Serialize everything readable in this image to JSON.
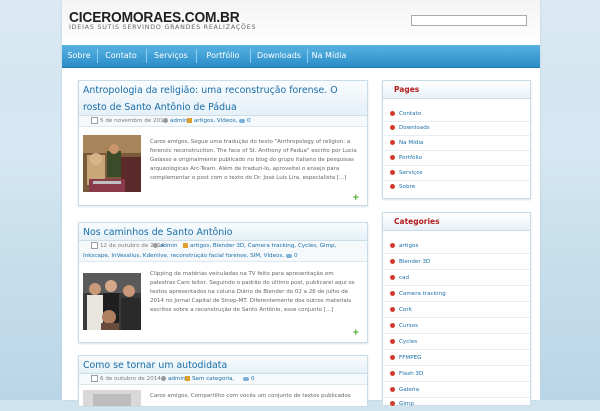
{
  "site": {
    "logo": "CICEROMORAES.COM.BR",
    "tagline": "IDEIAS SUTIS SERVINDO GRANDES REALIZAÇÕES"
  },
  "search": {
    "value": ""
  },
  "nav": [
    {
      "label": "Sobre"
    },
    {
      "label": "Contato"
    },
    {
      "label": "Serviços"
    },
    {
      "label": "Portfólio"
    },
    {
      "label": "Downloads"
    },
    {
      "label": "Na Mídia"
    }
  ],
  "posts": [
    {
      "title": "Antropologia da religião: uma reconstrução forense. O rosto de Santo Antônio de Pádua",
      "date": "5 de novembro de 2014",
      "author": "admin",
      "tags": "artigos, Vídeos,",
      "comments": "0",
      "excerpt": "Caros amigos, Segue uma tradução do texto \"Anthropology of religion: a forensic reconstruction. The face of St. Anthony of Padua\" escrito por Lucia Galasso e originalmente publicado no blog do grupo italiano de pesquisas arqueológicas Arc-Team. Além de traduzi-lo, aproveitei o ensejo para complementar o post com o texto do Dr. José Luís Lira, especialista [...]"
    },
    {
      "title": "Nos caminhos de Santo Antônio",
      "date": "12 de outubro de 2014",
      "author": "admin",
      "tags": "artigos, Blender 3D, Camera tracking, Cycles, Gimp, Inkscape, InVesalius, Kdenlive, reconstrução facial forense, SIM, Vídeos,",
      "comments": "0",
      "excerpt": "Clipping de matérias veiculadas na TV feito para apresentação em palestras Caro leitor, Seguindo o padrão do último post, publicarei aqui os textos apresentados na coluna Diário de Blender do 02 a 26 de julho de 2014 no Jornal Capital de Sinop-MT. Diferentemente dos outros materiais escritos sobre a reconstrução de Santo Antônio, esse conjunto [...]"
    },
    {
      "title": "Como se tornar um autodidata",
      "date": "6 de outubro de 2014",
      "author": "admin",
      "tags": "Sem categoria,",
      "comments": "0",
      "excerpt": "Caros amigos, Compartilho com vocês um conjunto de textos publicados"
    }
  ],
  "sidebar": {
    "pages": {
      "title": "Pages",
      "items": [
        "Contato",
        "Downloads",
        "Na Mídia",
        "Portfólio",
        "Serviços",
        "Sobre"
      ]
    },
    "categories": {
      "title": "Categories",
      "items": [
        "artigos",
        "Blender 3D",
        "cad",
        "Camera tracking",
        "Cork",
        "Cursos",
        "Cycles",
        "FFMPEG",
        "Flash 3D",
        "Galeria",
        "Gimp"
      ]
    }
  },
  "colors": {
    "nav": "#2b8cc8",
    "link": "#1a6ea8",
    "widget_title": "#b21e1e",
    "bullet": "#d23a2a",
    "more": "#4aaa2a"
  }
}
